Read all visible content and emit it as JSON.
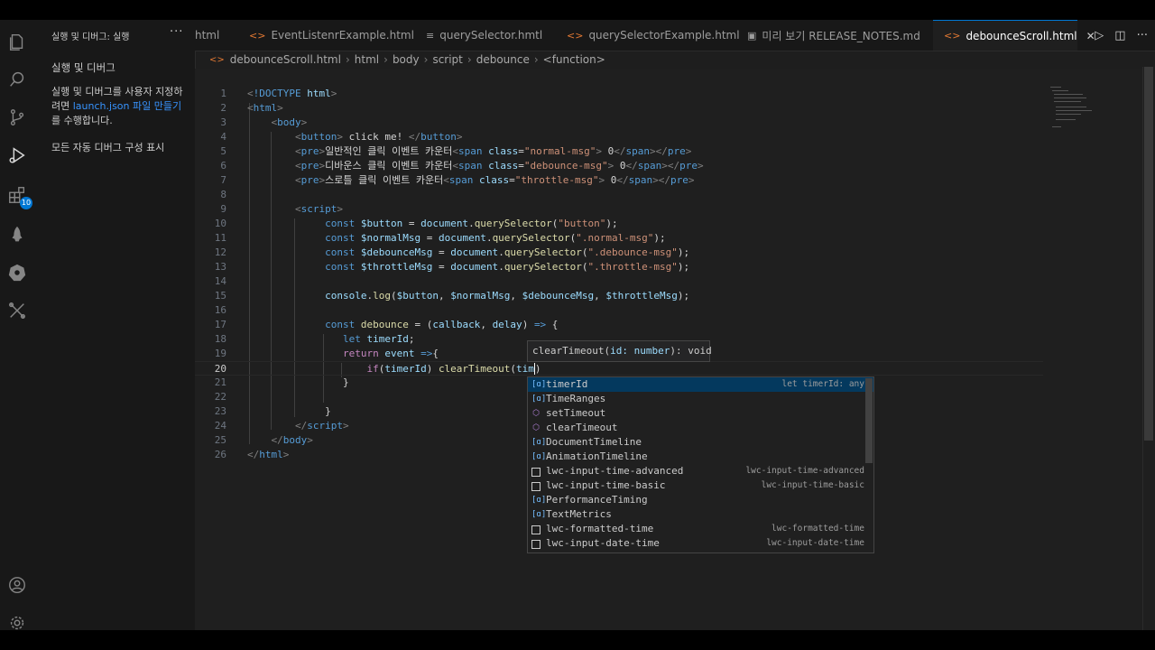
{
  "sidebar": {
    "title": "실행 및 디버그: 실행",
    "more": "···",
    "heading": "실행 및 디버그",
    "desc_before": "실행 및 디버그를 사용자 지정하려면 ",
    "desc_link": "launch.json 파일 만들기",
    "desc_after": "를 수행합니다.",
    "show_all": "모든 자동 디버그 구성 표시"
  },
  "activity_bar": {
    "badge_count": "10",
    "icons": [
      "files-icon",
      "search-icon",
      "source-control-icon",
      "run-debug-icon",
      "extensions-icon",
      "rocket-icon",
      "kubernetes-icon",
      "remote-tools-icon",
      "account-icon",
      "settings-icon"
    ]
  },
  "tabs": [
    {
      "label": "html",
      "icon": ""
    },
    {
      "label": "EventListenrExample.html",
      "icon": "<>"
    },
    {
      "label": "querySelector.hmtl",
      "icon": "≡"
    },
    {
      "label": "querySelectorExample.html",
      "icon": "<>"
    },
    {
      "label": "미리 보기 RELEASE_NOTES.md",
      "icon": "▣"
    },
    {
      "label": "debounceScroll.html",
      "icon": "<>",
      "active": true
    }
  ],
  "breadcrumb": [
    "debounceScroll.html",
    "html",
    "body",
    "script",
    "debounce",
    "<function>"
  ],
  "code": {
    "line_numbers": [
      "1",
      "2",
      "3",
      "4",
      "5",
      "6",
      "7",
      "8",
      "9",
      "10",
      "11",
      "12",
      "13",
      "14",
      "15",
      "16",
      "17",
      "18",
      "19",
      "20",
      "21",
      "22",
      "23",
      "24",
      "25",
      "26"
    ],
    "current_line": "20"
  },
  "tooltip": {
    "prefix": "clearTimeout(",
    "param": "id: number",
    "suffix": "): void"
  },
  "suggestions": [
    {
      "label": "timerId",
      "detail": "let timerId: any",
      "kind": "variable",
      "selected": true
    },
    {
      "label": "TimeRanges",
      "detail": "",
      "kind": "variable"
    },
    {
      "label": "setTimeout",
      "detail": "",
      "kind": "function"
    },
    {
      "label": "clearTimeout",
      "detail": "",
      "kind": "function"
    },
    {
      "label": "DocumentTimeline",
      "detail": "",
      "kind": "variable"
    },
    {
      "label": "AnimationTimeline",
      "detail": "",
      "kind": "variable"
    },
    {
      "label": "lwc-input-time-advanced",
      "detail": "lwc-input-time-advanced",
      "kind": "snippet"
    },
    {
      "label": "lwc-input-time-basic",
      "detail": "lwc-input-time-basic",
      "kind": "snippet"
    },
    {
      "label": "PerformanceTiming",
      "detail": "",
      "kind": "variable"
    },
    {
      "label": "TextMetrics",
      "detail": "",
      "kind": "variable"
    },
    {
      "label": "lwc-formatted-time",
      "detail": "lwc-formatted-time",
      "kind": "snippet"
    },
    {
      "label": "lwc-input-date-time",
      "detail": "lwc-input-date-time",
      "kind": "snippet"
    }
  ]
}
